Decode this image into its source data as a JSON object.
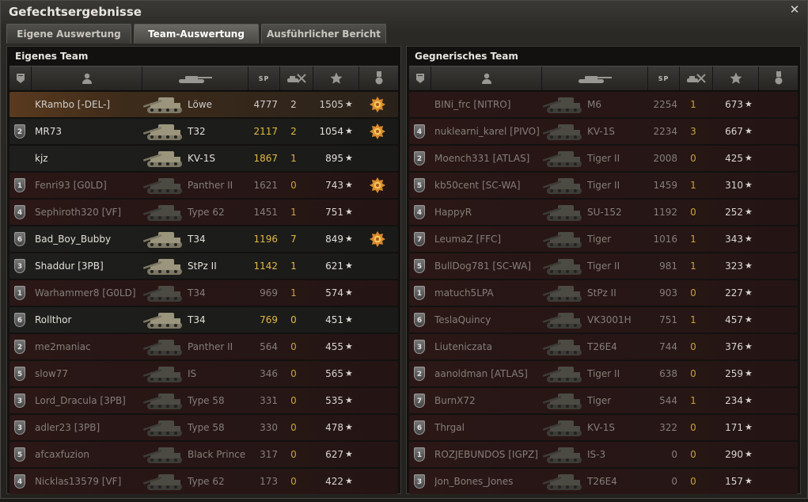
{
  "window": {
    "title": "Gefechtsergebnisse"
  },
  "tabs": [
    {
      "label": "Eigene Auswertung",
      "active": false
    },
    {
      "label": "Team-Auswertung",
      "active": true
    },
    {
      "label": "Ausführlicher Bericht",
      "active": false
    }
  ],
  "columns": {
    "sp_label": "SP"
  },
  "teams": [
    {
      "title": "Eigenes Team",
      "players": [
        {
          "squad": "",
          "name": "KRambo [-DEL-]",
          "tank": "Löwe",
          "exp": 4777,
          "kills": 2,
          "damage": 1505,
          "medal": true,
          "alive": true,
          "me": true
        },
        {
          "squad": "2",
          "name": "MR73",
          "tank": "T32",
          "exp": 2117,
          "kills": 2,
          "damage": 1054,
          "medal": true,
          "alive": true
        },
        {
          "squad": "",
          "name": "kjz",
          "tank": "KV-1S",
          "exp": 1867,
          "kills": 1,
          "damage": 895,
          "medal": false,
          "alive": true
        },
        {
          "squad": "1",
          "name": "Fenri93 [G0LD]",
          "tank": "Panther II",
          "exp": 1621,
          "kills": 0,
          "damage": 743,
          "medal": true,
          "alive": false
        },
        {
          "squad": "4",
          "name": "Sephiroth320 [VF]",
          "tank": "Type 62",
          "exp": 1451,
          "kills": 1,
          "damage": 751,
          "medal": false,
          "alive": false
        },
        {
          "squad": "6",
          "name": "Bad_Boy_Bubby",
          "tank": "T34",
          "exp": 1196,
          "kills": 7,
          "damage": 849,
          "medal": true,
          "alive": true
        },
        {
          "squad": "3",
          "name": "Shaddur [3PB]",
          "tank": "StPz II",
          "exp": 1142,
          "kills": 1,
          "damage": 621,
          "medal": false,
          "alive": true
        },
        {
          "squad": "1",
          "name": "Warhammer8 [G0LD]",
          "tank": "T34",
          "exp": 969,
          "kills": 1,
          "damage": 574,
          "medal": false,
          "alive": false
        },
        {
          "squad": "6",
          "name": "Rollthor",
          "tank": "T34",
          "exp": 769,
          "kills": 0,
          "damage": 451,
          "medal": false,
          "alive": true
        },
        {
          "squad": "2",
          "name": "me2maniac",
          "tank": "Panther II",
          "exp": 564,
          "kills": 0,
          "damage": 455,
          "medal": false,
          "alive": false
        },
        {
          "squad": "5",
          "name": "slow77",
          "tank": "IS",
          "exp": 346,
          "kills": 0,
          "damage": 565,
          "medal": false,
          "alive": false
        },
        {
          "squad": "3",
          "name": "Lord_Dracula [3PB]",
          "tank": "Type 58",
          "exp": 331,
          "kills": 0,
          "damage": 535,
          "medal": false,
          "alive": false
        },
        {
          "squad": "3",
          "name": "adler23 [3PB]",
          "tank": "Type 58",
          "exp": 330,
          "kills": 0,
          "damage": 478,
          "medal": false,
          "alive": false
        },
        {
          "squad": "5",
          "name": "afcaxfuzion",
          "tank": "Black Prince",
          "exp": 317,
          "kills": 0,
          "damage": 627,
          "medal": false,
          "alive": false
        },
        {
          "squad": "4",
          "name": "Nicklas13579 [VF]",
          "tank": "Type 62",
          "exp": 173,
          "kills": 0,
          "damage": 422,
          "medal": false,
          "alive": false
        }
      ]
    },
    {
      "title": "Gegnerisches Team",
      "players": [
        {
          "squad": "",
          "name": "BINi_frc [NITRO]",
          "tank": "M6",
          "exp": 2254,
          "kills": 1,
          "damage": 673,
          "medal": false,
          "alive": false
        },
        {
          "squad": "4",
          "name": "nuklearni_karel [PIVO]",
          "tank": "KV-1S",
          "exp": 2234,
          "kills": 3,
          "damage": 667,
          "medal": false,
          "alive": false
        },
        {
          "squad": "2",
          "name": "Moench331 [ATLAS]",
          "tank": "Tiger II",
          "exp": 2008,
          "kills": 0,
          "damage": 425,
          "medal": false,
          "alive": false
        },
        {
          "squad": "5",
          "name": "kb50cent [SC-WA]",
          "tank": "Tiger II",
          "exp": 1459,
          "kills": 1,
          "damage": 310,
          "medal": false,
          "alive": false
        },
        {
          "squad": "4",
          "name": "HappyR",
          "tank": "SU-152",
          "exp": 1192,
          "kills": 0,
          "damage": 252,
          "medal": false,
          "alive": false
        },
        {
          "squad": "7",
          "name": "LeumaZ [FFC]",
          "tank": "Tiger",
          "exp": 1016,
          "kills": 1,
          "damage": 343,
          "medal": false,
          "alive": false
        },
        {
          "squad": "5",
          "name": "BullDog781 [SC-WA]",
          "tank": "Tiger II",
          "exp": 981,
          "kills": 1,
          "damage": 323,
          "medal": false,
          "alive": false
        },
        {
          "squad": "1",
          "name": "matuch5LPA",
          "tank": "StPz II",
          "exp": 903,
          "kills": 0,
          "damage": 227,
          "medal": false,
          "alive": false
        },
        {
          "squad": "6",
          "name": "TeslaQuincy",
          "tank": "VK3001H",
          "exp": 751,
          "kills": 1,
          "damage": 457,
          "medal": false,
          "alive": false
        },
        {
          "squad": "3",
          "name": "Liuteniczata",
          "tank": "T26E4",
          "exp": 744,
          "kills": 0,
          "damage": 376,
          "medal": false,
          "alive": false
        },
        {
          "squad": "2",
          "name": "aanoldman [ATLAS]",
          "tank": "Tiger II",
          "exp": 638,
          "kills": 0,
          "damage": 259,
          "medal": false,
          "alive": false
        },
        {
          "squad": "7",
          "name": "BurnX72",
          "tank": "Tiger",
          "exp": 544,
          "kills": 1,
          "damage": 234,
          "medal": false,
          "alive": false
        },
        {
          "squad": "6",
          "name": "Thrgal",
          "tank": "KV-1S",
          "exp": 322,
          "kills": 0,
          "damage": 171,
          "medal": false,
          "alive": false
        },
        {
          "squad": "1",
          "name": "ROZJEBUNDOS [IGPZ]",
          "tank": "IS-3",
          "exp": 0,
          "kills": 0,
          "damage": 290,
          "medal": false,
          "alive": false
        },
        {
          "squad": "3",
          "name": "Jon_Bones_Jones",
          "tank": "T26E4",
          "exp": 0,
          "kills": 0,
          "damage": 157,
          "medal": false,
          "alive": false
        }
      ]
    }
  ]
}
